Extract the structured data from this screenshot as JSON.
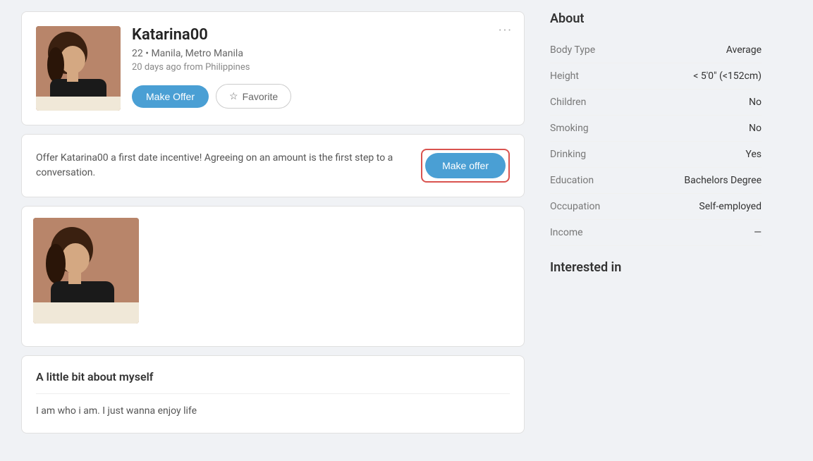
{
  "profile": {
    "username": "Katarina00",
    "age": "22",
    "location": "Manila, Metro Manila",
    "last_active": "20 days ago from Philippines",
    "make_offer_label": "Make Offer",
    "favorite_label": "Favorite",
    "three_dots": "···"
  },
  "offer_banner": {
    "text": "Offer Katarina00 a first date incentive! Agreeing on an amount is the first step to a conversation.",
    "button_label": "Make offer"
  },
  "about_section": {
    "title": "A little bit about myself",
    "bio": "I am who i am. I just wanna enjoy life"
  },
  "sidebar": {
    "about_title": "About",
    "interested_title": "Interested in",
    "rows": [
      {
        "label": "Body Type",
        "value": "Average"
      },
      {
        "label": "Height",
        "value": "< 5'0\" (<152cm)"
      },
      {
        "label": "Children",
        "value": "No"
      },
      {
        "label": "Smoking",
        "value": "No"
      },
      {
        "label": "Drinking",
        "value": "Yes"
      },
      {
        "label": "Education",
        "value": "Bachelors Degree"
      },
      {
        "label": "Occupation",
        "value": "Self-employed"
      },
      {
        "label": "Income",
        "value": "—"
      }
    ]
  }
}
